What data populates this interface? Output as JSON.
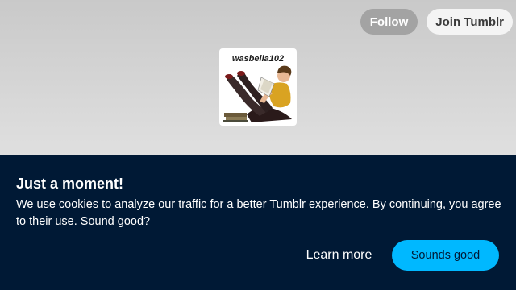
{
  "header": {
    "follow_label": "Follow",
    "join_label": "Join Tumblr"
  },
  "blog": {
    "avatar_caption": "wasbella102",
    "avatar_icon": "pinup-reading-illustration"
  },
  "cookie_banner": {
    "title": "Just a moment!",
    "message": "We use cookies to analyze our traffic for a better Tumblr experience. By continuing, you agree to their use. Sound good?",
    "learn_more_label": "Learn more",
    "accept_label": "Sounds good"
  },
  "colors": {
    "banner_bg": "#001935",
    "accent": "#00b8ff",
    "follow_bg": "#a3a3a3"
  }
}
